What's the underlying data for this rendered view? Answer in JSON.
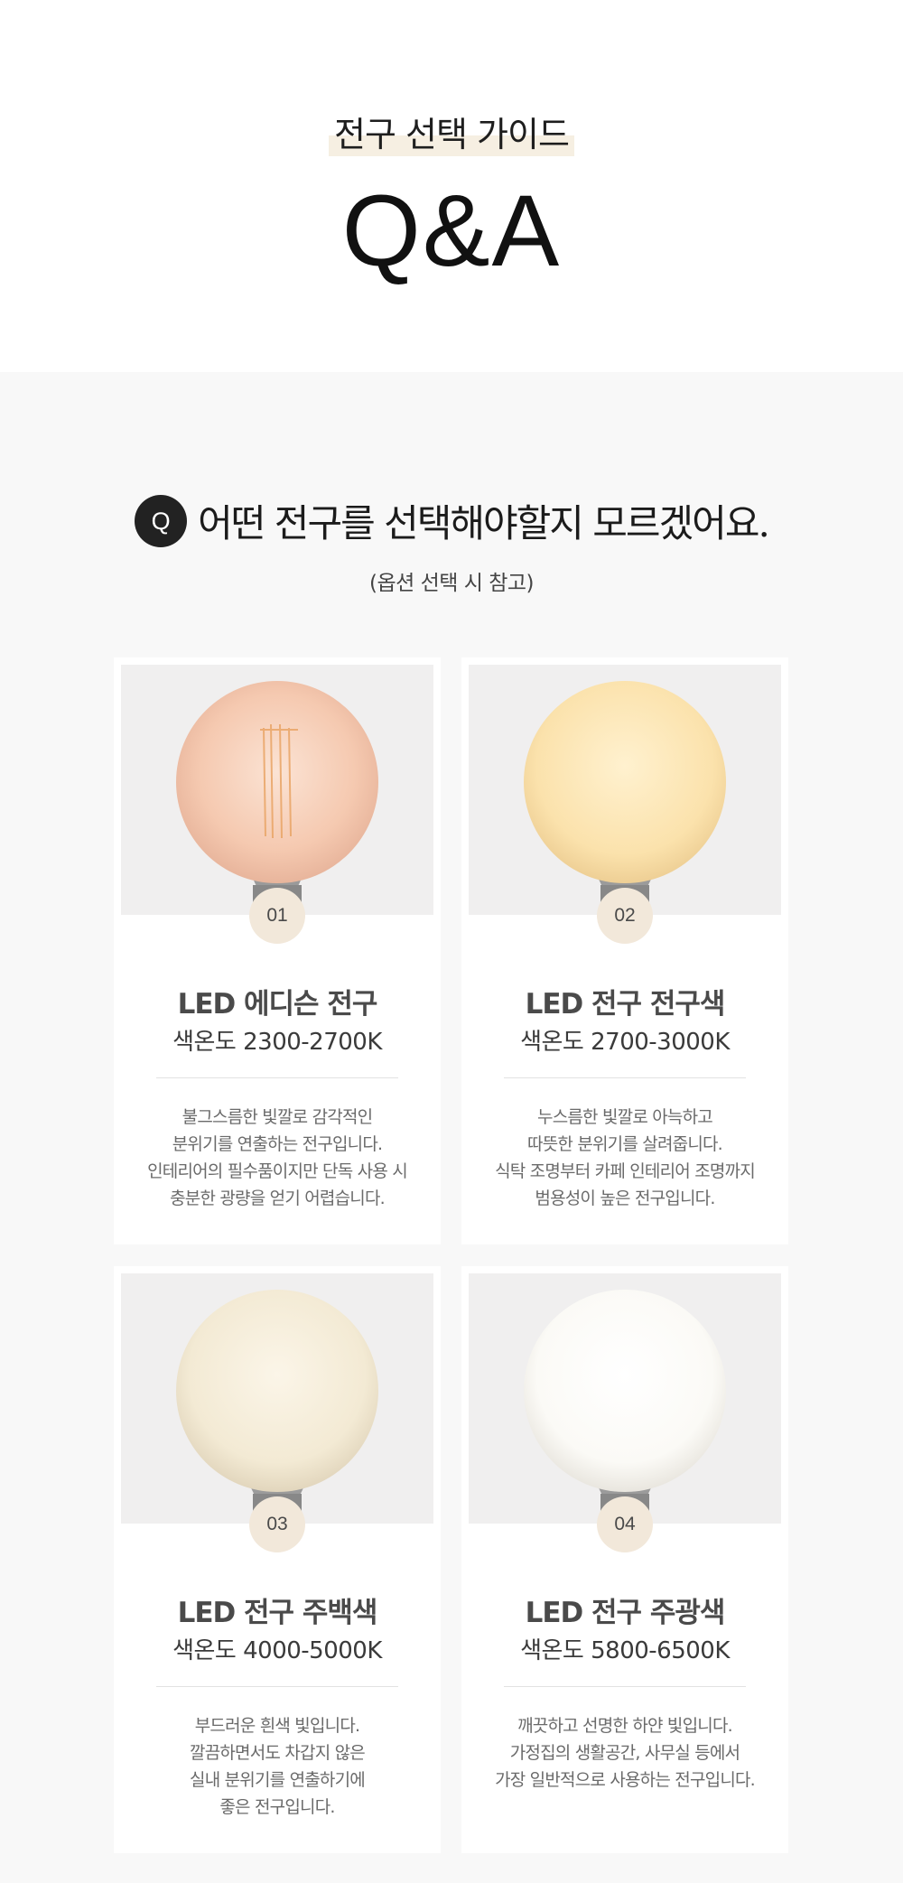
{
  "header": {
    "subtitle": "전구 선택 가이드",
    "title": "Q&A"
  },
  "question": {
    "badge": "Q",
    "text": "어떤 전구를 선택해야할지 모르겠어요.",
    "note": "(옵션 선택 시 참고)"
  },
  "cards": [
    {
      "number": "01",
      "name": "LED 에디슨 전구",
      "color_temp": "색온도 2300-2700K",
      "desc": [
        "불그스름한 빛깔로 감각적인",
        "분위기를 연출하는 전구입니다.",
        "인테리어의 필수품이지만 단독 사용 시",
        "충분한 광량을 얻기 어렵습니다."
      ],
      "bulb_color": "#f7d2bc"
    },
    {
      "number": "02",
      "name": "LED 전구 전구색",
      "color_temp": "색온도 2700-3000K",
      "desc": [
        "누스름한 빛깔로 아늑하고",
        "따뜻한 분위기를 살려줍니다.",
        "식탁 조명부터 카페 인테리어 조명까지",
        "범용성이 높은  전구입니다."
      ],
      "bulb_color": "#fbe6b6"
    },
    {
      "number": "03",
      "name": "LED 전구 주백색",
      "color_temp": "색온도 4000-5000K",
      "desc": [
        "부드러운 흰색 빛입니다.",
        "깔끔하면서도 차갑지 않은",
        "실내 분위기를 연출하기에",
        "좋은 전구입니다."
      ],
      "bulb_color": "#f6eedc"
    },
    {
      "number": "04",
      "name": "LED 전구 주광색",
      "color_temp": "색온도 5800-6500K",
      "desc": [
        "깨끗하고 선명한 하얀 빛입니다.",
        "가정집의 생활공간, 사무실 등에서",
        "가장 일반적으로 사용하는 전구입니다."
      ],
      "bulb_color": "#fbfaf7"
    }
  ]
}
